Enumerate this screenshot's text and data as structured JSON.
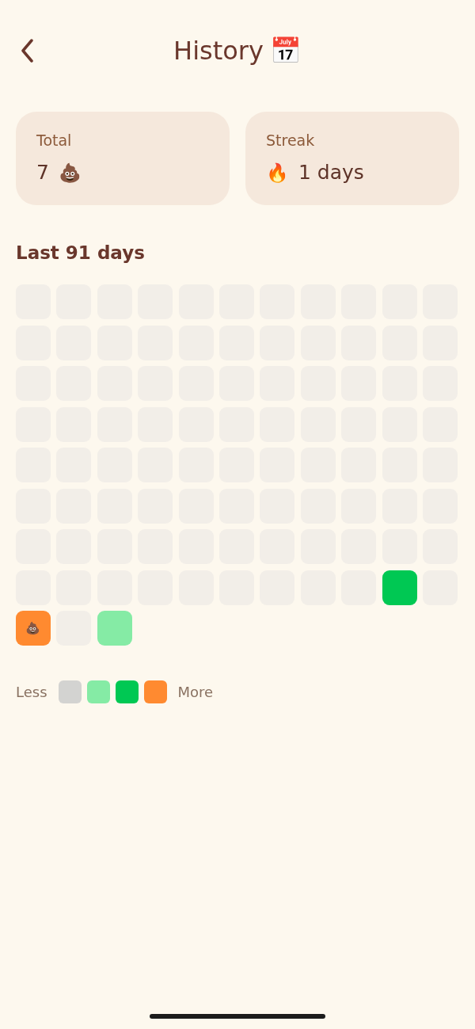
{
  "header": {
    "title": "History",
    "emoji": "📅"
  },
  "stats": [
    {
      "label": "Total",
      "parts": [
        {
          "kind": "text",
          "text": "7"
        },
        {
          "kind": "emoji",
          "text": "💩"
        }
      ]
    },
    {
      "label": "Streak",
      "parts": [
        {
          "kind": "emoji",
          "text": "🔥"
        },
        {
          "kind": "text",
          "text": "1 days"
        }
      ]
    }
  ],
  "section_title": "Last 91 days",
  "days": [
    {
      "color": "#f2eee8"
    },
    {
      "color": "#f2eee8"
    },
    {
      "color": "#f2eee8"
    },
    {
      "color": "#f2eee8"
    },
    {
      "color": "#f2eee8"
    },
    {
      "color": "#f2eee8"
    },
    {
      "color": "#f2eee8"
    },
    {
      "color": "#f2eee8"
    },
    {
      "color": "#f2eee8"
    },
    {
      "color": "#f2eee8"
    },
    {
      "color": "#f2eee8"
    },
    {
      "color": "#f2eee8"
    },
    {
      "color": "#f2eee8"
    },
    {
      "color": "#f2eee8"
    },
    {
      "color": "#f2eee8"
    },
    {
      "color": "#f2eee8"
    },
    {
      "color": "#f2eee8"
    },
    {
      "color": "#f2eee8"
    },
    {
      "color": "#f2eee8"
    },
    {
      "color": "#f2eee8"
    },
    {
      "color": "#f2eee8"
    },
    {
      "color": "#f2eee8"
    },
    {
      "color": "#f2eee8"
    },
    {
      "color": "#f2eee8"
    },
    {
      "color": "#f2eee8"
    },
    {
      "color": "#f2eee8"
    },
    {
      "color": "#f2eee8"
    },
    {
      "color": "#f2eee8"
    },
    {
      "color": "#f2eee8"
    },
    {
      "color": "#f2eee8"
    },
    {
      "color": "#f2eee8"
    },
    {
      "color": "#f2eee8"
    },
    {
      "color": "#f2eee8"
    },
    {
      "color": "#f2eee8"
    },
    {
      "color": "#f2eee8"
    },
    {
      "color": "#f2eee8"
    },
    {
      "color": "#f2eee8"
    },
    {
      "color": "#f2eee8"
    },
    {
      "color": "#f2eee8"
    },
    {
      "color": "#f2eee8"
    },
    {
      "color": "#f2eee8"
    },
    {
      "color": "#f2eee8"
    },
    {
      "color": "#f2eee8"
    },
    {
      "color": "#f2eee8"
    },
    {
      "color": "#f2eee8"
    },
    {
      "color": "#f2eee8"
    },
    {
      "color": "#f2eee8"
    },
    {
      "color": "#f2eee8"
    },
    {
      "color": "#f2eee8"
    },
    {
      "color": "#f2eee8"
    },
    {
      "color": "#f2eee8"
    },
    {
      "color": "#f2eee8"
    },
    {
      "color": "#f2eee8"
    },
    {
      "color": "#f2eee8"
    },
    {
      "color": "#f2eee8"
    },
    {
      "color": "#f2eee8"
    },
    {
      "color": "#f2eee8"
    },
    {
      "color": "#f2eee8"
    },
    {
      "color": "#f2eee8"
    },
    {
      "color": "#f2eee8"
    },
    {
      "color": "#f2eee8"
    },
    {
      "color": "#f2eee8"
    },
    {
      "color": "#f2eee8"
    },
    {
      "color": "#f2eee8"
    },
    {
      "color": "#f2eee8"
    },
    {
      "color": "#f2eee8"
    },
    {
      "color": "#f2eee8"
    },
    {
      "color": "#f2eee8"
    },
    {
      "color": "#f2eee8"
    },
    {
      "color": "#f2eee8"
    },
    {
      "color": "#f2eee8"
    },
    {
      "color": "#f2eee8"
    },
    {
      "color": "#f2eee8"
    },
    {
      "color": "#f2eee8"
    },
    {
      "color": "#f2eee8"
    },
    {
      "color": "#f2eee8"
    },
    {
      "color": "#f2eee8"
    },
    {
      "color": "#f2eee8"
    },
    {
      "color": "#f2eee8"
    },
    {
      "color": "#f2eee8"
    },
    {
      "color": "#f2eee8"
    },
    {
      "color": "#f2eee8"
    },
    {
      "color": "#f2eee8"
    },
    {
      "color": "#f2eee8"
    },
    {
      "color": "#f2eee8"
    },
    {
      "color": "#f2eee8"
    },
    {
      "color": "#00c853"
    },
    {
      "color": "#f2eee8"
    },
    {
      "color": "#ff8a30",
      "emoji": "💩"
    },
    {
      "color": "#f2eee8"
    },
    {
      "color": "#85eba5"
    }
  ],
  "legend": {
    "start": "Less",
    "swatches": [
      {
        "color": "#d3d3d1"
      },
      {
        "color": "#85eba5"
      },
      {
        "color": "#00c853"
      },
      {
        "color": "#ff8a30"
      }
    ],
    "end": "More"
  }
}
